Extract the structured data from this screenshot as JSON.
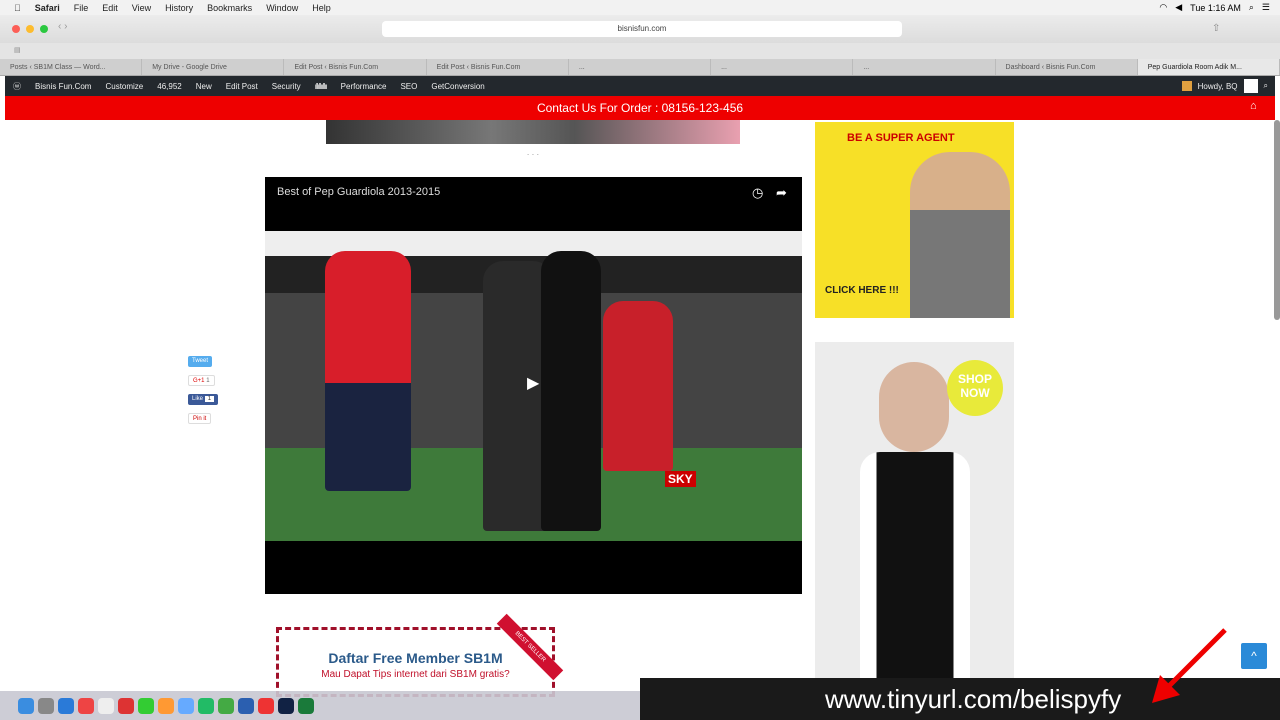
{
  "menubar": {
    "app": "Safari",
    "items": [
      "File",
      "Edit",
      "View",
      "History",
      "Bookmarks",
      "Window",
      "Help"
    ],
    "clock": "Tue 1:16 AM"
  },
  "browser": {
    "url": "bisnisfun.com",
    "tabs": [
      "Posts ‹ SB1M Class — Word...",
      "My Drive - Google Drive",
      "Edit Post ‹ Bisnis Fun.Com",
      "Edit Post ‹ Bisnis Fun.Com",
      "...",
      "...",
      "...",
      "Dashboard ‹ Bisnis Fun.Com",
      "Pep Guardiola Room Adik M..."
    ]
  },
  "wpbar": {
    "site": "Bisnis Fun.Com",
    "customize": "Customize",
    "comments": "46,952",
    "new": "New",
    "edit": "Edit Post",
    "security": "Security",
    "performance": "Performance",
    "seo": "SEO",
    "getconversion": "GetConversion",
    "howdy": "Howdy, BQ"
  },
  "contact": "Contact Us For Order : 08156-123-456",
  "video": {
    "title": "Best of Pep Guardiola 2013-2015",
    "badge": "SKY"
  },
  "share": {
    "tweet": "Tweet",
    "gplus": "G+1",
    "gcount": "1",
    "like": "Like",
    "likecount": "1",
    "pin": "Pin it"
  },
  "ads": {
    "agent": "BE A SUPER AGENT",
    "click": "CLICK HERE !!!",
    "shop": "SHOP NOW"
  },
  "member": {
    "title": "Daftar Free Member SB1M",
    "subtitle": "Mau Dapat Tips internet dari SB1M gratis?",
    "ribbon": "BEST SELLER"
  },
  "overlay": {
    "url": "www.tinyurl.com/belispyfy"
  },
  "colors": {
    "red": "#ee0000",
    "wp": "#23282d",
    "accent": "#2a8ad8"
  }
}
